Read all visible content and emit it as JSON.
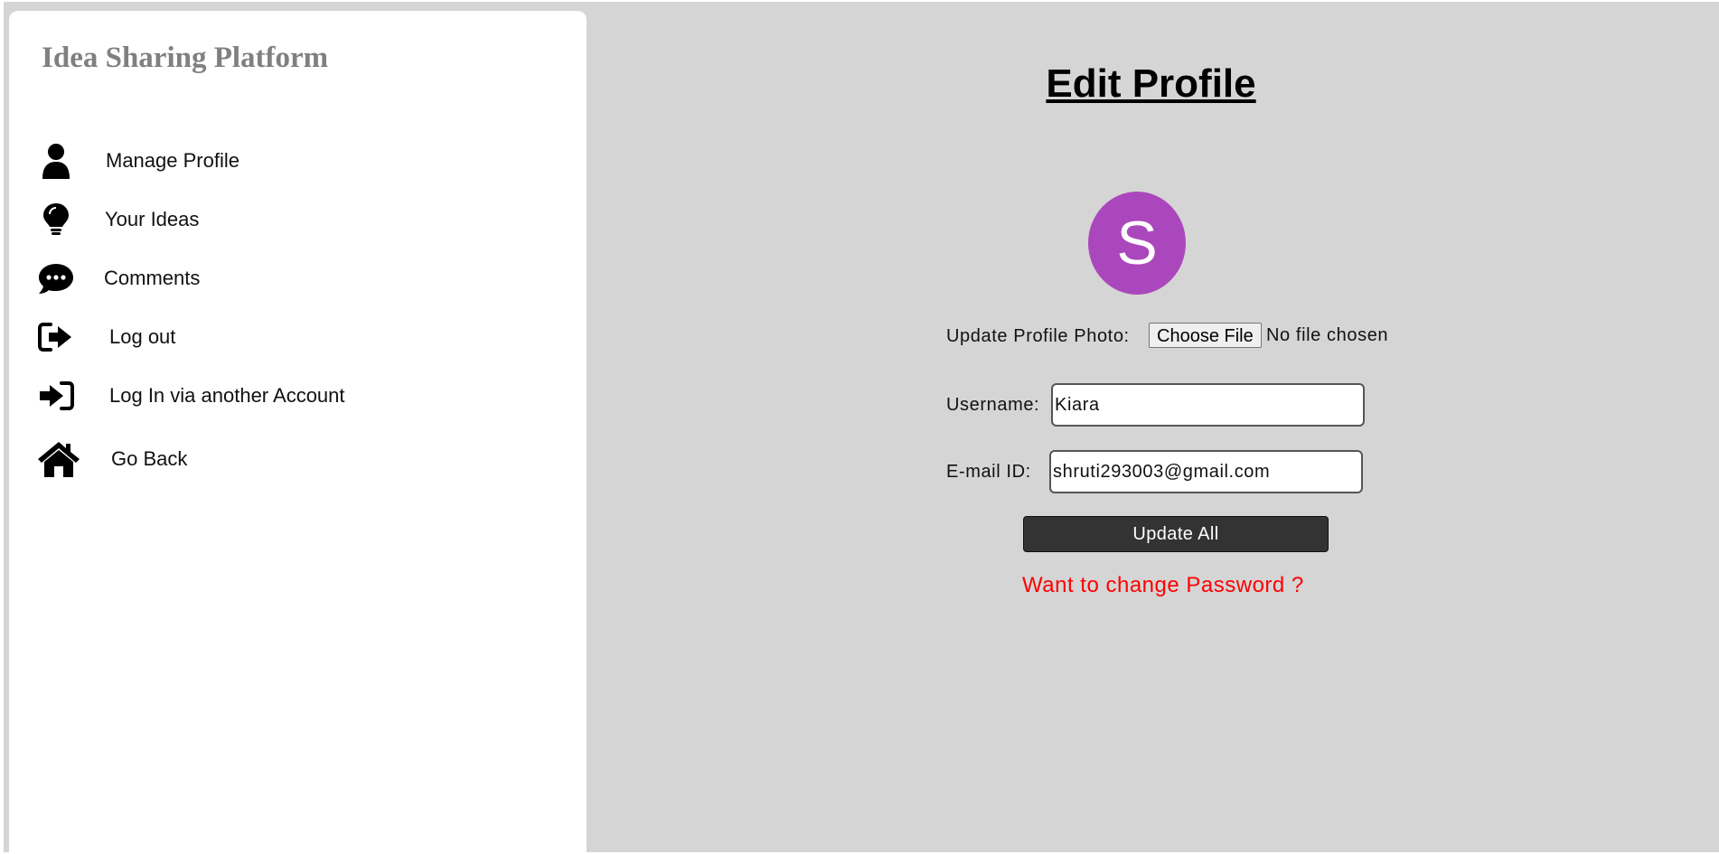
{
  "sidebar": {
    "brand": "Idea Sharing Platform",
    "items": [
      {
        "label": "Manage Profile",
        "icon": "person-icon"
      },
      {
        "label": "Your Ideas",
        "icon": "lightbulb-icon"
      },
      {
        "label": "Comments",
        "icon": "comment-dots-icon"
      },
      {
        "label": "Log out",
        "icon": "sign-out-icon"
      },
      {
        "label": "Log In via another Account",
        "icon": "sign-in-icon"
      },
      {
        "label": "Go Back",
        "icon": "home-icon"
      }
    ]
  },
  "main": {
    "title": "Edit Profile",
    "avatar_letter": "S",
    "avatar_color": "#ab47bc",
    "photo_label": "Update Profile Photo:",
    "file_button": "Choose File",
    "file_status": "No file chosen",
    "username_label": "Username:",
    "username_value": "Kiara",
    "email_label": "E-mail ID:",
    "email_value": "shruti293003@gmail.com",
    "update_button": "Update All",
    "password_link": "Want to change Password ?"
  },
  "colors": {
    "background": "#d5d5d5",
    "brand_text": "#808080",
    "button_bg": "#333333",
    "link": "#ff0000"
  }
}
